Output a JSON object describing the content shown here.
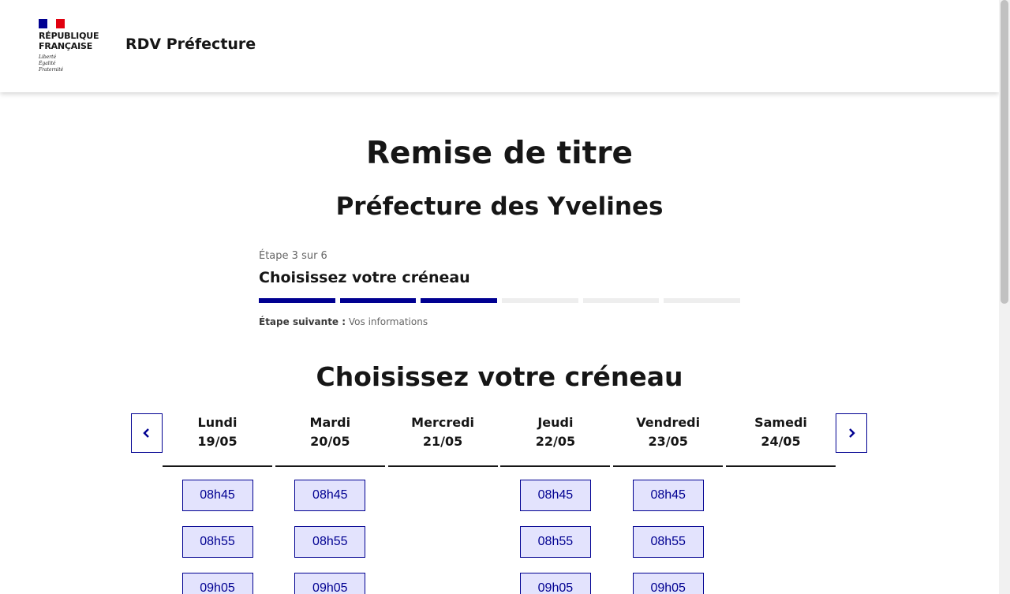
{
  "header": {
    "logo_line1": "RÉPUBLIQUE",
    "logo_line2": "FRANÇAISE",
    "devise1": "Liberté",
    "devise2": "Égalité",
    "devise3": "Fraternité",
    "service_title": "RDV Préfecture"
  },
  "page": {
    "title": "Remise de titre",
    "subtitle": "Préfecture des Yvelines"
  },
  "stepper": {
    "state": "Étape 3 sur 6",
    "title": "Choisissez votre créneau",
    "current_step": 3,
    "total_steps": 6,
    "next_label": "Étape suivante :",
    "next_value": "Vos informations"
  },
  "calendar": {
    "title": "Choisissez votre créneau",
    "prev_icon": "chevron-left-icon",
    "next_icon": "chevron-right-icon",
    "days": [
      {
        "name": "Lundi",
        "date": "19/05",
        "slots": [
          "08h45",
          "08h55",
          "09h05"
        ]
      },
      {
        "name": "Mardi",
        "date": "20/05",
        "slots": [
          "08h45",
          "08h55",
          "09h05"
        ]
      },
      {
        "name": "Mercredi",
        "date": "21/05",
        "slots": []
      },
      {
        "name": "Jeudi",
        "date": "22/05",
        "slots": [
          "08h45",
          "08h55",
          "09h05"
        ]
      },
      {
        "name": "Vendredi",
        "date": "23/05",
        "slots": [
          "08h45",
          "08h55",
          "09h05"
        ]
      },
      {
        "name": "Samedi",
        "date": "24/05",
        "slots": []
      }
    ]
  },
  "colors": {
    "primary": "#000091",
    "slot_bg": "#e3e3fd",
    "flag_red": "#e1000f"
  }
}
